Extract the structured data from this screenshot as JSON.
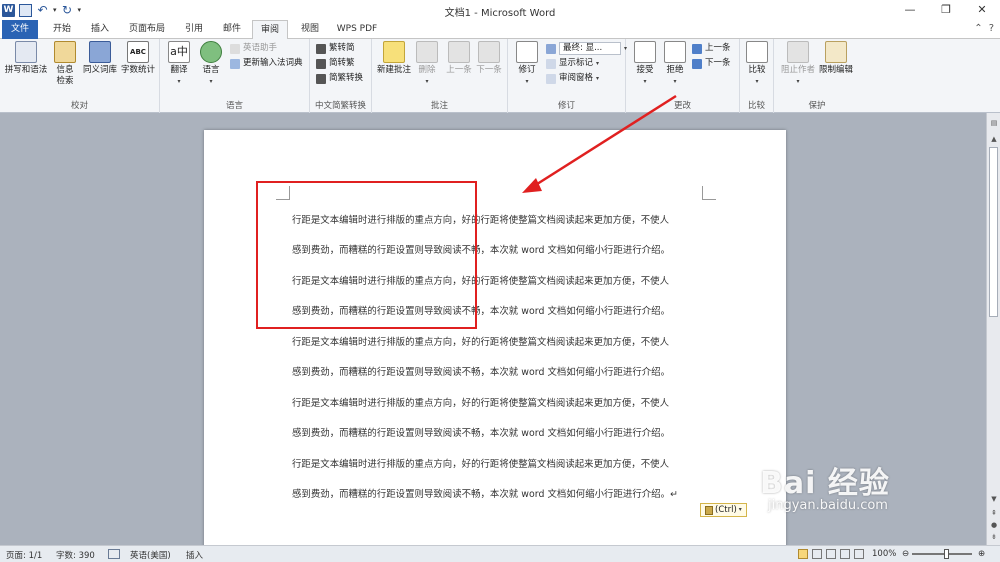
{
  "window": {
    "title": "文档1 - Microsoft Word"
  },
  "qat": {
    "icons": [
      "word-logo-icon",
      "save-icon",
      "undo-icon",
      "redo-icon"
    ],
    "logo_letter": "W"
  },
  "tabs": [
    "文件",
    "开始",
    "插入",
    "页面布局",
    "引用",
    "邮件",
    "审阅",
    "视图",
    "WPS PDF"
  ],
  "active_tab": "审阅",
  "ribbon": {
    "proofing": {
      "label": "校对",
      "spelling": "拼写和语法",
      "research": "信息\n检索",
      "thesaurus": "同义词库",
      "wordcount": "字数统计"
    },
    "language": {
      "label": "语言",
      "translate": "翻译",
      "language": "语言",
      "assistant": "英语助手",
      "update_ime": "更新输入法词典"
    },
    "chinese": {
      "label": "中文简繁转换",
      "to_simplified": "繁转简",
      "to_traditional": "简转繁",
      "convert": "简繁转换"
    },
    "comments": {
      "label": "批注",
      "new": "新建批注",
      "delete": "删除",
      "prev": "上一条",
      "next": "下一条"
    },
    "tracking": {
      "label": "修订",
      "track": "修订",
      "display_value": "最终: 显...",
      "show_markup": "显示标记",
      "reviewing_pane": "审阅窗格"
    },
    "changes": {
      "label": "更改",
      "accept": "接受",
      "reject": "拒绝",
      "prev": "上一条",
      "next": "下一条"
    },
    "compare": {
      "label": "比较",
      "compare": "比较"
    },
    "protect": {
      "label": "保护",
      "block_authors": "阻止作者",
      "restrict": "限制编辑"
    }
  },
  "document": {
    "lines": [
      "行距是文本编辑时进行排版的重点方向，好的行距将使整篇文档阅读起来更加方便，不使人",
      "感到费劲，而糟糕的行距设置则导致阅读不畅，本次就 word 文档如何缩小行距进行介绍。",
      "行距是文本编辑时进行排版的重点方向，好的行距将使整篇文档阅读起来更加方便，不使人",
      "感到费劲，而糟糕的行距设置则导致阅读不畅，本次就 word 文档如何缩小行距进行介绍。",
      "行距是文本编辑时进行排版的重点方向，好的行距将使整篇文档阅读起来更加方便，不使人",
      "感到费劲，而糟糕的行距设置则导致阅读不畅，本次就 word 文档如何缩小行距进行介绍。",
      "行距是文本编辑时进行排版的重点方向，好的行距将使整篇文档阅读起来更加方便，不使人",
      "感到费劲，而糟糕的行距设置则导致阅读不畅，本次就 word 文档如何缩小行距进行介绍。",
      "行距是文本编辑时进行排版的重点方向，好的行距将使整篇文档阅读起来更加方便，不使人",
      "感到费劲，而糟糕的行距设置则导致阅读不畅，本次就 word 文档如何缩小行距进行介绍。↵"
    ],
    "paste_options": "(Ctrl)"
  },
  "status": {
    "page": "页面: 1/1",
    "words": "字数: 390",
    "language": "英语(美国)",
    "mode": "插入",
    "zoom": "100%"
  },
  "watermark": {
    "main": "Bai 经验",
    "url": "jingyan.baidu.com"
  },
  "colors": {
    "file_tab": "#2a63b4",
    "annotation": "#e02020"
  }
}
